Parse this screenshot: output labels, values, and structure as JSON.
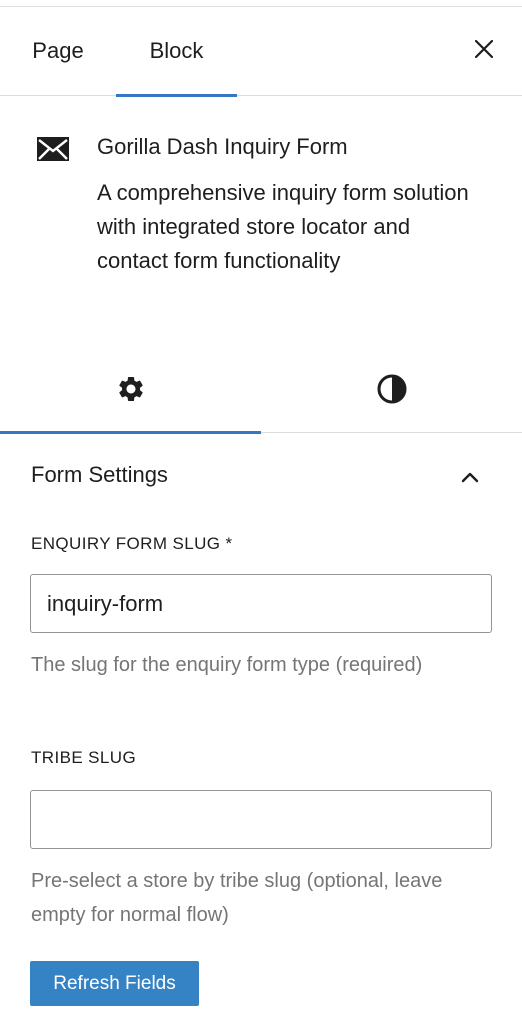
{
  "header": {
    "tabs": [
      {
        "label": "Page",
        "active": false
      },
      {
        "label": "Block",
        "active": true
      }
    ],
    "close_icon": "close-icon"
  },
  "block": {
    "icon": "envelope-icon",
    "title": "Gorilla Dash Inquiry Form",
    "description": "A comprehensive inquiry form solution with integrated store locator and contact form functionality"
  },
  "inspector_tabs": [
    {
      "icon": "gear-icon",
      "active": true
    },
    {
      "icon": "contrast-icon",
      "active": false
    }
  ],
  "form_settings": {
    "title": "Form Settings",
    "expanded": true,
    "enquiry_slug": {
      "label": "ENQUIRY FORM SLUG *",
      "value": "inquiry-form",
      "help": "The slug for the enquiry form type (required)"
    },
    "tribe_slug": {
      "label": "TRIBE SLUG",
      "value": "",
      "help": "Pre-select a store by tribe slug (optional, leave empty for normal flow)"
    },
    "refresh_label": "Refresh Fields"
  },
  "colors": {
    "accent": "#3477c4",
    "button": "#3582c4",
    "help_text": "#757575",
    "border": "#949494"
  }
}
